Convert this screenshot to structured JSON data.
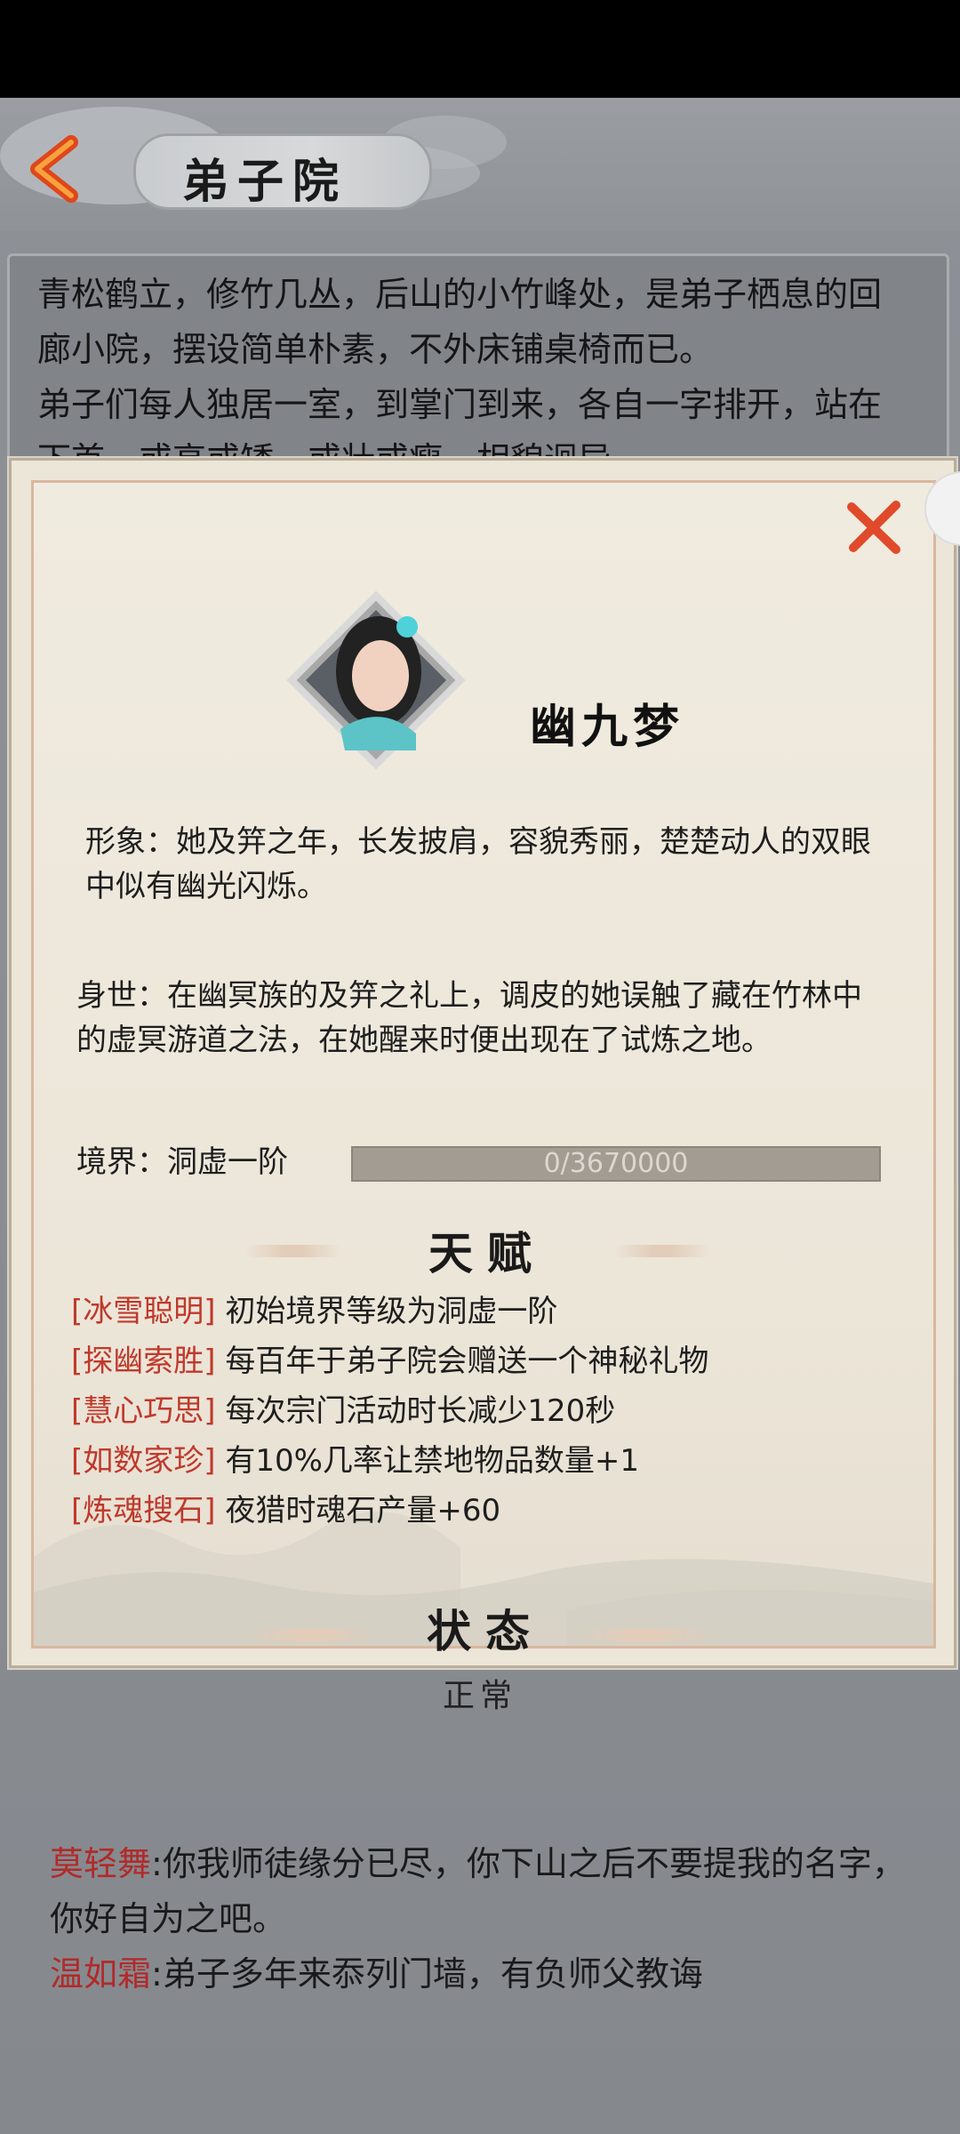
{
  "header": {
    "title": "弟子院",
    "back_icon": "chevron-left-icon",
    "accent": "#e0461c"
  },
  "description": {
    "paragraph1": "青松鹤立，修竹几丛，后山的小竹峰处，是弟子栖息的回廊小院，摆设简单朴素，不外床铺桌椅而已。",
    "paragraph2": "弟子们每人独居一室，到掌门到来，各自一字排开，站在下首，或高或矮，或壮或瘦，相貌迥异。"
  },
  "character": {
    "name": "幽九梦",
    "appearance": "形象：她及笄之年，长发披肩，容貌秀丽，楚楚动人的双眼中似有幽光闪烁。",
    "background": "身世：在幽冥族的及笄之礼上，调皮的她误触了藏在竹林中的虚冥游道之法，在她醒来时便出现在了试炼之地。",
    "realm_label": "境界：洞虚一阶",
    "progress_text": "0/3670000",
    "progress_fraction": 0
  },
  "talents": {
    "title": "天赋",
    "items": [
      {
        "name": "[冰雪聪明]",
        "desc": "初始境界等级为洞虚一阶"
      },
      {
        "name": "[探幽索胜]",
        "desc": "每百年于弟子院会赠送一个神秘礼物"
      },
      {
        "name": "[慧心巧思]",
        "desc": "每次宗门活动时长减少120秒"
      },
      {
        "name": "[如数家珍]",
        "desc": "有10%几率让禁地物品数量+1"
      },
      {
        "name": "[炼魂搜石]",
        "desc": "夜猎时魂石产量+60"
      }
    ]
  },
  "status": {
    "title": "状态",
    "value": "正常"
  },
  "chat": [
    {
      "speaker": "莫轻舞",
      "text": ":你我师徒缘分已尽，你下山之后不要提我的名字，你好自为之吧。"
    },
    {
      "speaker": "温如霜",
      "text": ":弟子多年来忝列门墙，有负师父教诲"
    }
  ],
  "close_icon": "close-x-icon",
  "colors": {
    "talent_name": "#c0392b",
    "close": "#e04a2a",
    "progress_bg": "#a39c93"
  }
}
